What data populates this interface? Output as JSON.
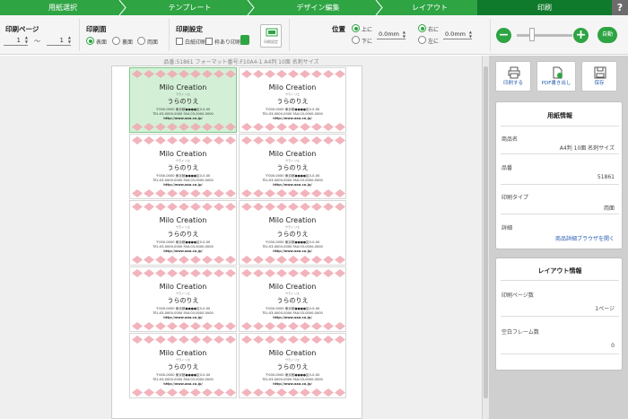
{
  "steps": [
    {
      "label": "用紙選択"
    },
    {
      "label": "テンプレート"
    },
    {
      "label": "デザイン編集"
    },
    {
      "label": "レイアウト"
    },
    {
      "label": "印刷"
    }
  ],
  "help_label": "?",
  "toolbar": {
    "print_page_label": "印刷ページ",
    "page_from": "1",
    "page_to": "1",
    "page_sep": "～",
    "print_side_label": "印刷面",
    "side_options": [
      "表面",
      "裏面",
      "両面"
    ],
    "print_setting_label": "印刷設定",
    "setting_options": [
      "白紙印刷",
      "枠あり印刷"
    ],
    "print_confirm_label": "印刷設定",
    "position_label": "位置",
    "vertical_options": [
      "上に",
      "下に"
    ],
    "horizontal_options": [
      "右に",
      "左に"
    ],
    "vertical_value": "0.0mm",
    "horizontal_value": "0.0mm",
    "zoom_minus": "−",
    "zoom_plus": "+",
    "auto_label": "自動"
  },
  "canvas": {
    "caption": "品番:51861 フォーマット番号:F10A4-1 A4判 10面 名刺サイズ"
  },
  "card": {
    "title": "Milo Creation",
    "furigana": "ウラノ リエ",
    "name": "うらのりえ",
    "addr1": "〒000-0000 東京都●●●●区0-0-00",
    "addr2": "TEL:03-0000-0000 FAX:03-0000-0000",
    "addr3": "http://www.aaa.co.jp/"
  },
  "actions": [
    {
      "label": "印刷する",
      "icon": "printer-icon"
    },
    {
      "label": "PDF書き出し",
      "icon": "pdf-export-icon"
    },
    {
      "label": "保存",
      "icon": "save-icon"
    }
  ],
  "paper_info": {
    "title": "用紙情報",
    "product_label": "商品名",
    "product_value": "A4判 10面 名刺サイズ",
    "number_label": "品番",
    "number_value": "51861",
    "type_label": "印刷タイプ",
    "type_value": "両面",
    "detail_label": "詳細",
    "detail_value": "商品詳細ブラウザを開く"
  },
  "layout_info": {
    "title": "レイアウト情報",
    "pages_label": "印刷ページ数",
    "pages_value": "1ページ",
    "blank_label": "空白フレーム数",
    "blank_value": "0"
  },
  "colors": {
    "accent": "#2ea443",
    "active_step": "#0f7a2b",
    "diamond": "#f0a7b0",
    "link": "#2a5db0"
  }
}
